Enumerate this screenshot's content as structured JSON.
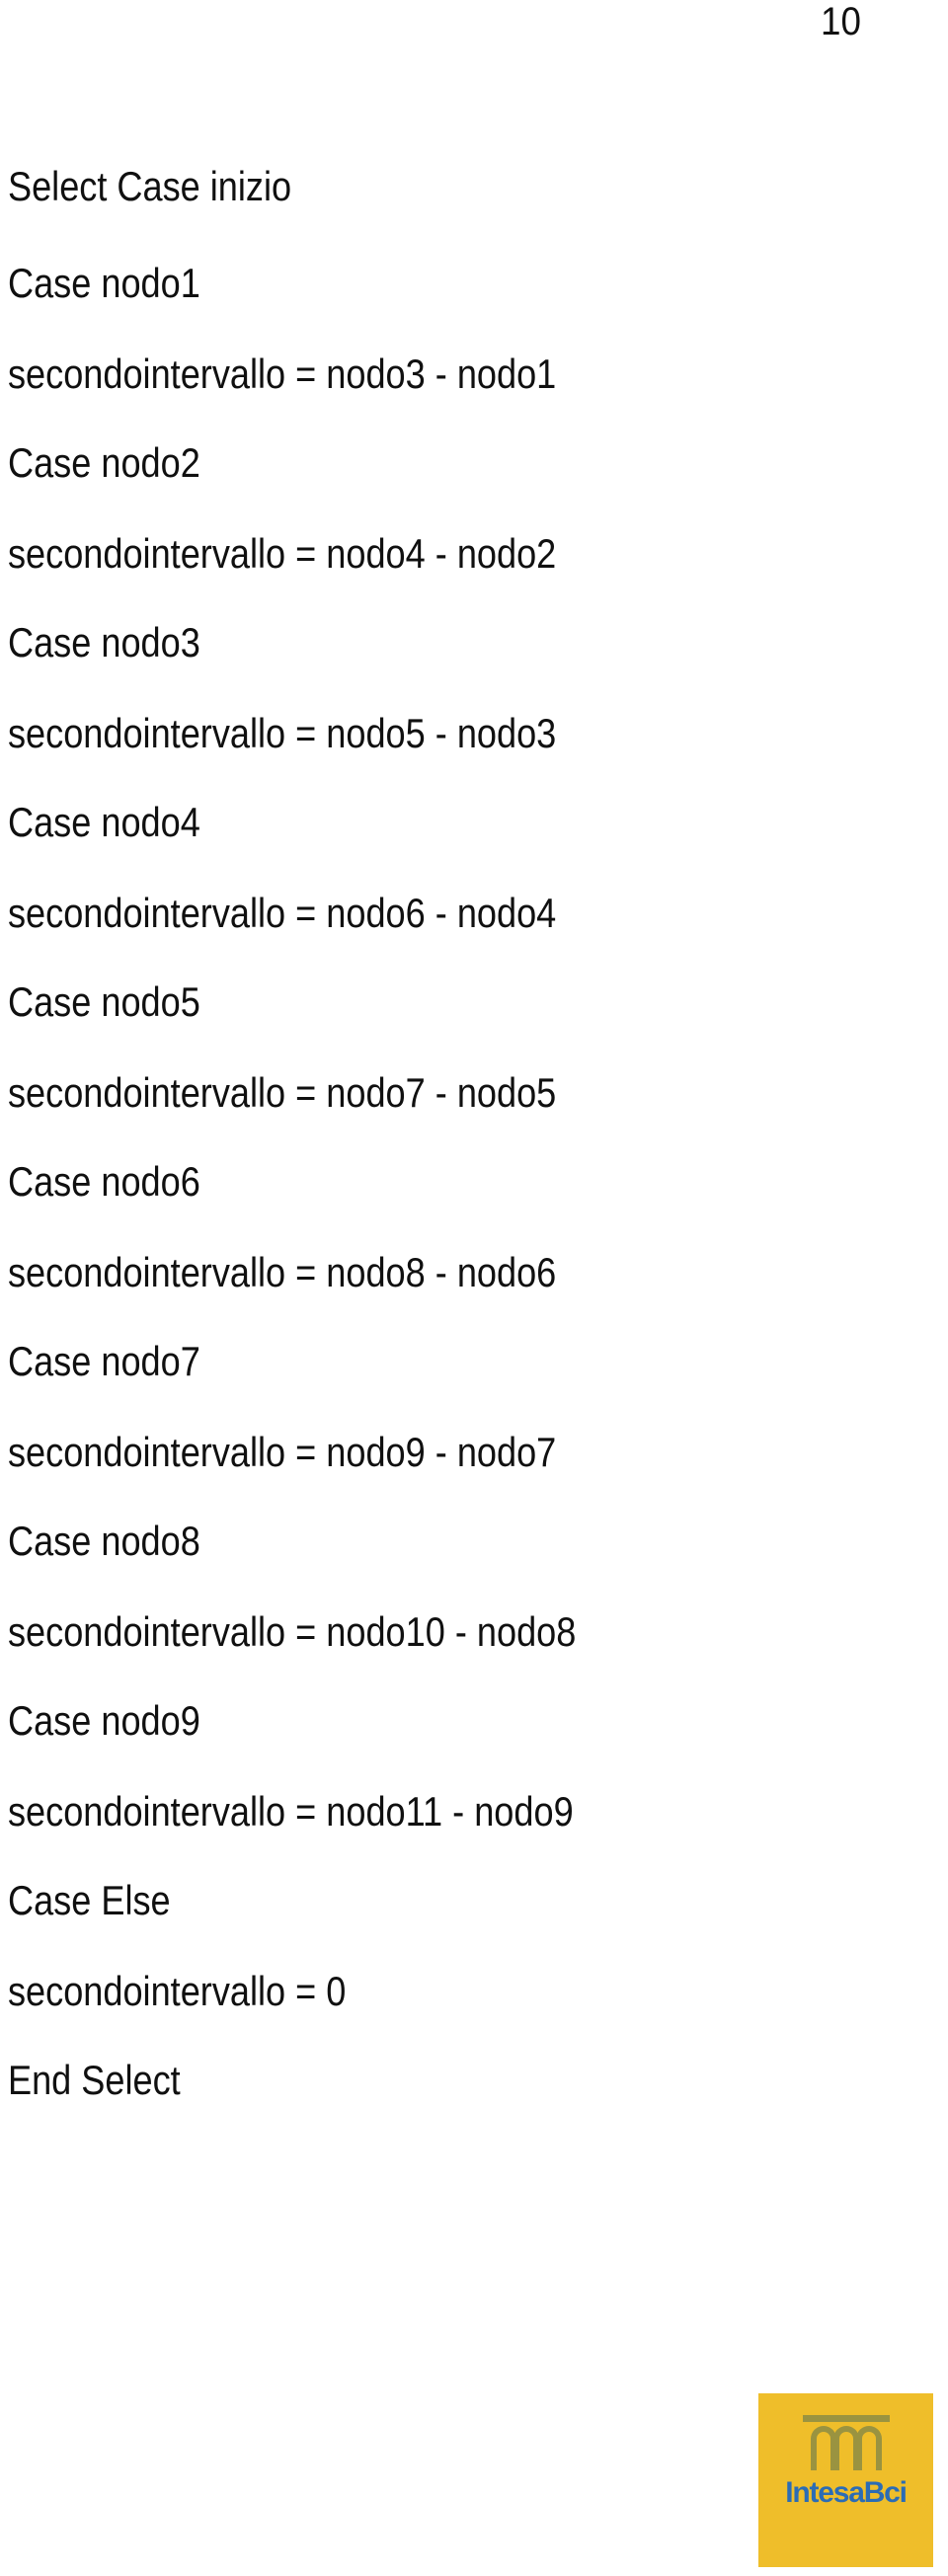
{
  "page": {
    "number": "10",
    "background_color": "#ffffff",
    "text_color": "#101010"
  },
  "listing": {
    "lines": [
      {
        "text": "Select Case inizio",
        "kind": "keyword"
      },
      {
        "text": "Case nodo1",
        "kind": "keyword"
      },
      {
        "text": "secondointervallo = nodo3 - nodo1",
        "kind": "statement"
      },
      {
        "text": "Case nodo2",
        "kind": "keyword"
      },
      {
        "text": "secondointervallo = nodo4 - nodo2",
        "kind": "statement"
      },
      {
        "text": "Case nodo3",
        "kind": "keyword"
      },
      {
        "text": "secondointervallo = nodo5 - nodo3",
        "kind": "statement"
      },
      {
        "text": "Case nodo4",
        "kind": "keyword"
      },
      {
        "text": "secondointervallo = nodo6 - nodo4",
        "kind": "statement"
      },
      {
        "text": "Case nodo5",
        "kind": "keyword"
      },
      {
        "text": "secondointervallo = nodo7 - nodo5",
        "kind": "statement"
      },
      {
        "text": "Case nodo6",
        "kind": "keyword"
      },
      {
        "text": "secondointervallo = nodo8 - nodo6",
        "kind": "statement"
      },
      {
        "text": "Case nodo7",
        "kind": "keyword"
      },
      {
        "text": "secondointervallo = nodo9 - nodo7",
        "kind": "statement"
      },
      {
        "text": "Case nodo8",
        "kind": "keyword"
      },
      {
        "text": "secondointervallo = nodo10 - nodo8",
        "kind": "statement"
      },
      {
        "text": "Case nodo9",
        "kind": "keyword"
      },
      {
        "text": "secondointervallo = nodo11 - nodo9",
        "kind": "statement"
      },
      {
        "text": "Case Else",
        "kind": "keyword"
      },
      {
        "text": "secondointervallo = 0",
        "kind": "statement"
      },
      {
        "text": "End Select",
        "kind": "keyword"
      }
    ]
  },
  "logo": {
    "wordmark": "IntesaBci",
    "background_color": "#efbe2a",
    "ink_color": "#2b6cb5",
    "mark_name": "arcade-bridge-icon"
  }
}
